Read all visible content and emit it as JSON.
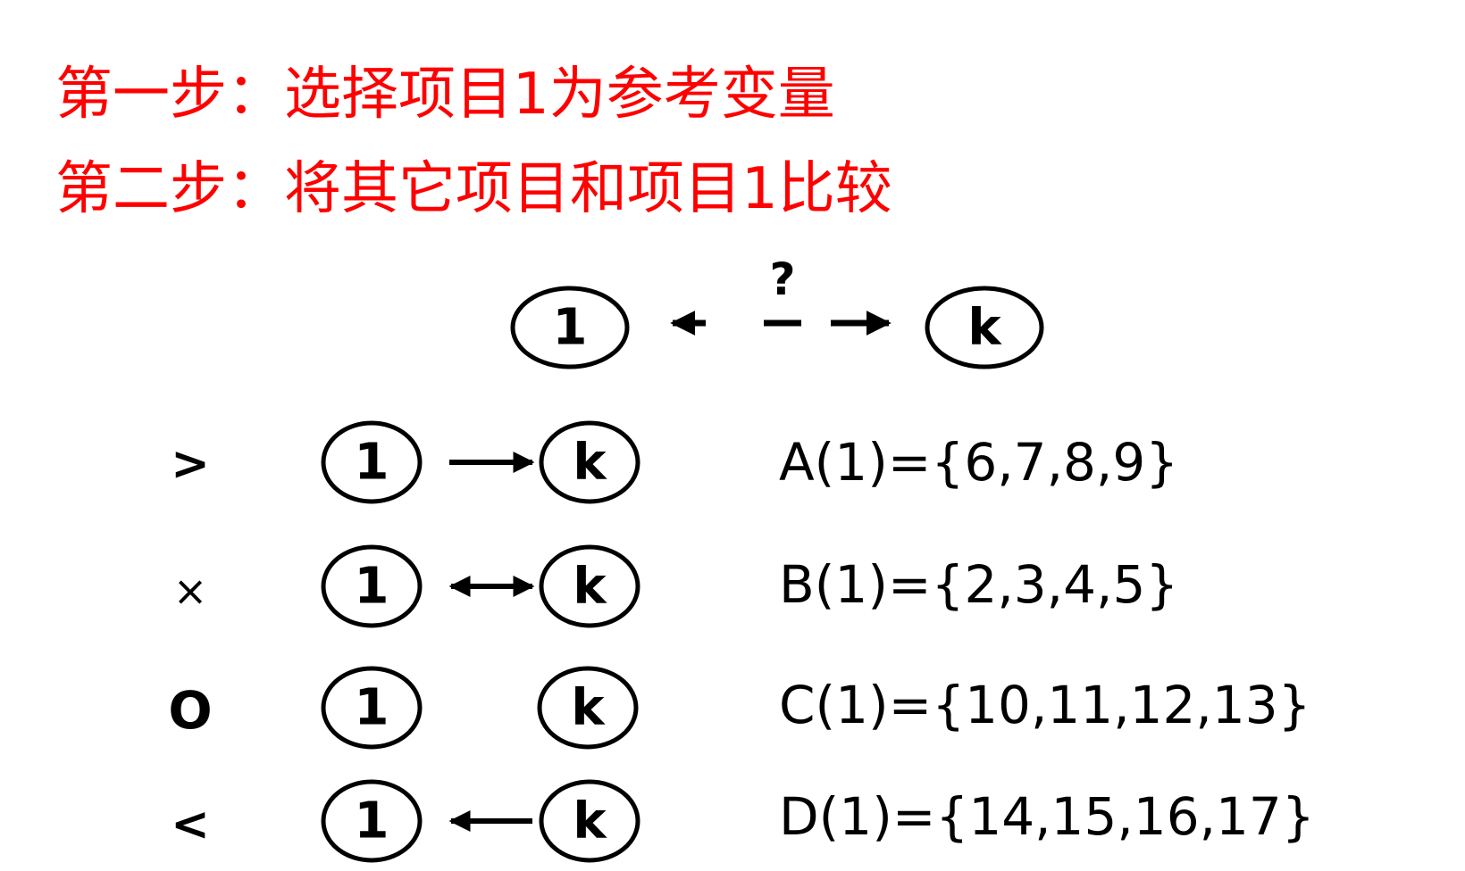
{
  "steps": {
    "step1": "第一步：选择项目1为参考变量",
    "step2": "第二步：将其它项目和项目1比较"
  },
  "header": {
    "left_node": "1",
    "right_node": "k",
    "question": "?"
  },
  "rows": [
    {
      "symbol": ">",
      "left_node": "1",
      "right_node": "k",
      "relation": "right",
      "set": "A(1)={6,7,8,9}"
    },
    {
      "symbol": "×",
      "left_node": "1",
      "right_node": "k",
      "relation": "both",
      "set": "B(1)={2,3,4,5}"
    },
    {
      "symbol": "O",
      "left_node": "1",
      "right_node": "k",
      "relation": "none",
      "set": "C(1)={10,11,12,13}"
    },
    {
      "symbol": "<",
      "left_node": "1",
      "right_node": "k",
      "relation": "left",
      "set": "D(1)={14,15,16,17}"
    }
  ],
  "colors": {
    "step_text": "#ff0000",
    "diagram": "#000000"
  }
}
